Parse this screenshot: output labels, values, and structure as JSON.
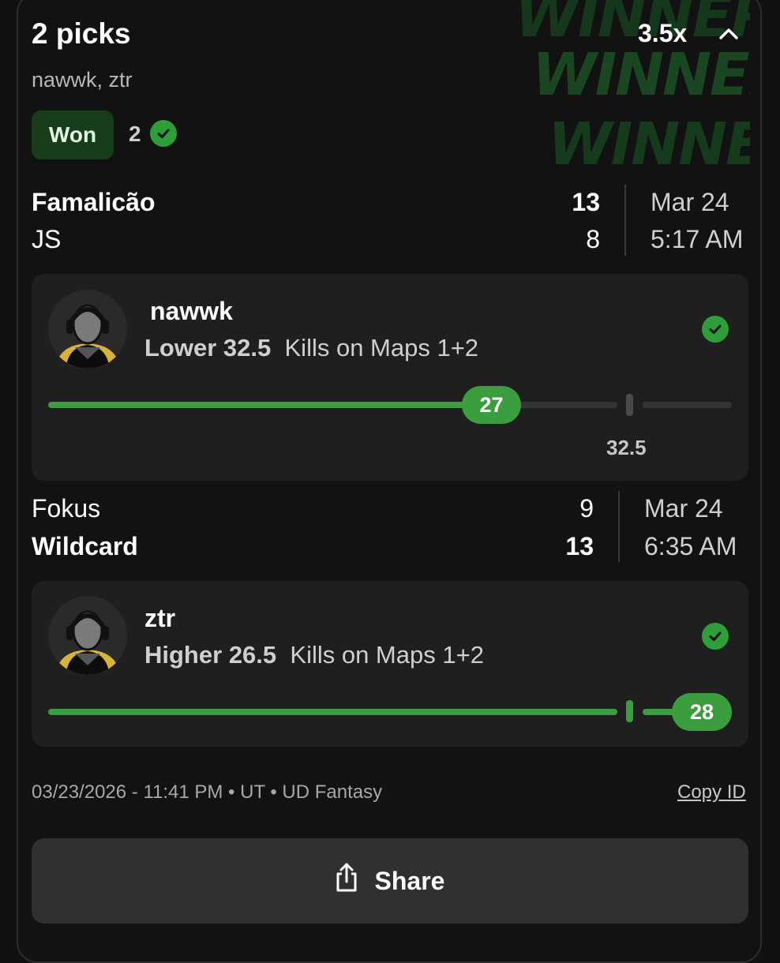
{
  "header": {
    "title": "2 picks",
    "multiplier": "3.5x",
    "players": "nawwk, ztr",
    "watermark": "WINNER!!"
  },
  "status": {
    "badge": "Won",
    "correct_count": "2"
  },
  "colors": {
    "accent_green": "#3a9d3e",
    "badge_bg": "#173d1a",
    "card_bg": "#1f1f1f"
  },
  "matches": [
    {
      "team1": {
        "name": "Famalicão",
        "score": "13"
      },
      "team2": {
        "name": "JS",
        "score": "8"
      },
      "date": "Mar 24",
      "time": "5:17 AM",
      "pick": {
        "player": "nawwk",
        "direction": "Lower",
        "line": "32.5",
        "stat": "Kills on Maps 1+2",
        "result": "27",
        "result_value": 27,
        "line_value": 32.5,
        "line_label": "32.5",
        "status_icon": "check-circle-icon"
      }
    },
    {
      "team1": {
        "name": "Fokus",
        "score": "9"
      },
      "team2": {
        "name": "Wildcard",
        "score": "13"
      },
      "date": "Mar 24",
      "time": "6:35 AM",
      "pick": {
        "player": "ztr",
        "direction": "Higher",
        "line": "26.5",
        "stat": "Kills on Maps 1+2",
        "result": "28",
        "result_value": 28,
        "line_value": 26.5,
        "status_icon": "check-circle-icon"
      }
    }
  ],
  "footer": {
    "meta": "03/23/2026 - 11:41 PM • UT • UD Fantasy",
    "copy_id": "Copy ID",
    "share": "Share"
  }
}
